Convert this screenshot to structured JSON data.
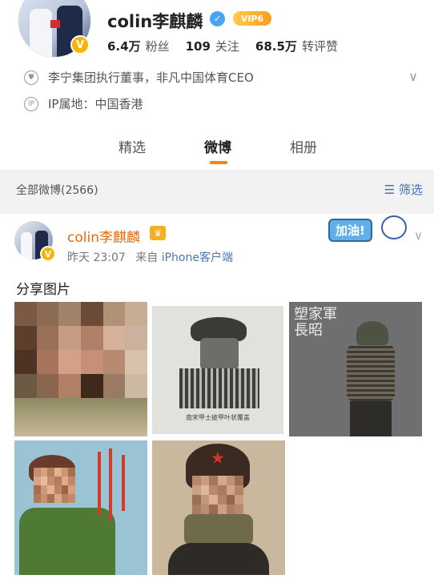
{
  "profile": {
    "name": "colin李麒麟",
    "vip_label": "VIP6",
    "stats": [
      {
        "value": "6.4万",
        "label": "粉丝"
      },
      {
        "value": "109",
        "label": "关注"
      },
      {
        "value": "68.5万",
        "label": "转评赞"
      }
    ],
    "bio": "李宁集团执行董事，非凡中国体育CEO",
    "ip_label": "IP属地：中国香港"
  },
  "tabs": [
    {
      "label": "精选",
      "active": false
    },
    {
      "label": "微博",
      "active": true
    },
    {
      "label": "相册",
      "active": false
    }
  ],
  "filterbar": {
    "all_label": "全部微博(2566)",
    "filter_label": "筛选"
  },
  "post": {
    "author": "colin李麒麟",
    "time": "昨天 23:07",
    "source_prefix": "来自",
    "source": "iPhone客户端",
    "sticker_text": "加油!",
    "text": "分享图片",
    "images": [
      {
        "alt": "pixelated portrait in brown tones"
      },
      {
        "alt": "ink drawing of armored soldier",
        "caption": "南宋甲士披甲叶状覆盖"
      },
      {
        "alt": "armored figurine with calligraphy",
        "caption": "塑家軍長昭"
      },
      {
        "alt": "poster of soldier in green uniform with red calligraphy"
      },
      {
        "alt": "pixelated portrait wearing fur hat with red star"
      }
    ]
  },
  "colors": {
    "accent": "#ff8200",
    "link": "#3f72af",
    "verified": "#4aa3f0",
    "vip": "#f7b500"
  }
}
